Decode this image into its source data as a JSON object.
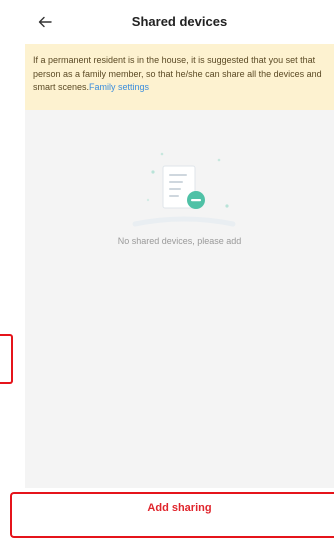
{
  "header": {
    "title": "Shared devices",
    "back_icon": "arrow-left-icon"
  },
  "notice": {
    "text": "If a permanent resident is in the house, it is suggested that you set that person as a family member, so that he/she can share all the devices and smart scenes.",
    "link_label": "Family settings"
  },
  "empty_state": {
    "message": "No shared devices, please add",
    "icon": "document-minus-icon"
  },
  "footer": {
    "add_label": "Add sharing"
  },
  "colors": {
    "accent": "#e0252c",
    "link": "#3a8ddd",
    "notice_bg": "#fdf2d0",
    "highlight": "#e5141b"
  }
}
